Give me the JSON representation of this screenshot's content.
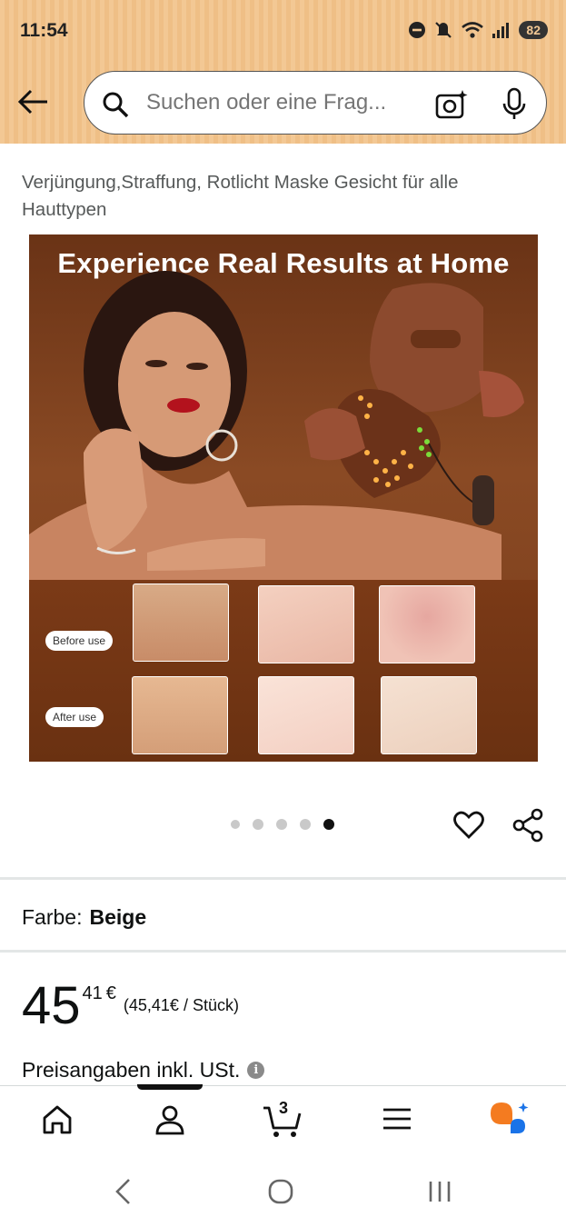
{
  "status_bar": {
    "time": "11:54",
    "battery": "82"
  },
  "search": {
    "placeholder": "Suchen oder eine Frag..."
  },
  "product": {
    "title_line_1": "Verjüngung,Straffung, Rotlicht Maske Gesicht für alle",
    "title_line_2": "Hauttypen",
    "image": {
      "headline": "Experience Real Results at Home",
      "before_label": "Before use",
      "after_label": "After use"
    },
    "carousel": {
      "count": 5,
      "active_index": 4
    },
    "color_label": "Farbe:",
    "color_value": "Beige",
    "price_whole": "45",
    "price_fraction": "41",
    "currency": "€",
    "unit_price": "(45,41€ / Stück)",
    "vat_note": "Preisangaben inkl. USt."
  },
  "bottom_nav": {
    "cart_count": "3"
  },
  "colors": {
    "header_bg": "#f3c894",
    "active": "#111111",
    "assistant_orange": "#f47b20",
    "assistant_blue": "#1a73e8"
  }
}
